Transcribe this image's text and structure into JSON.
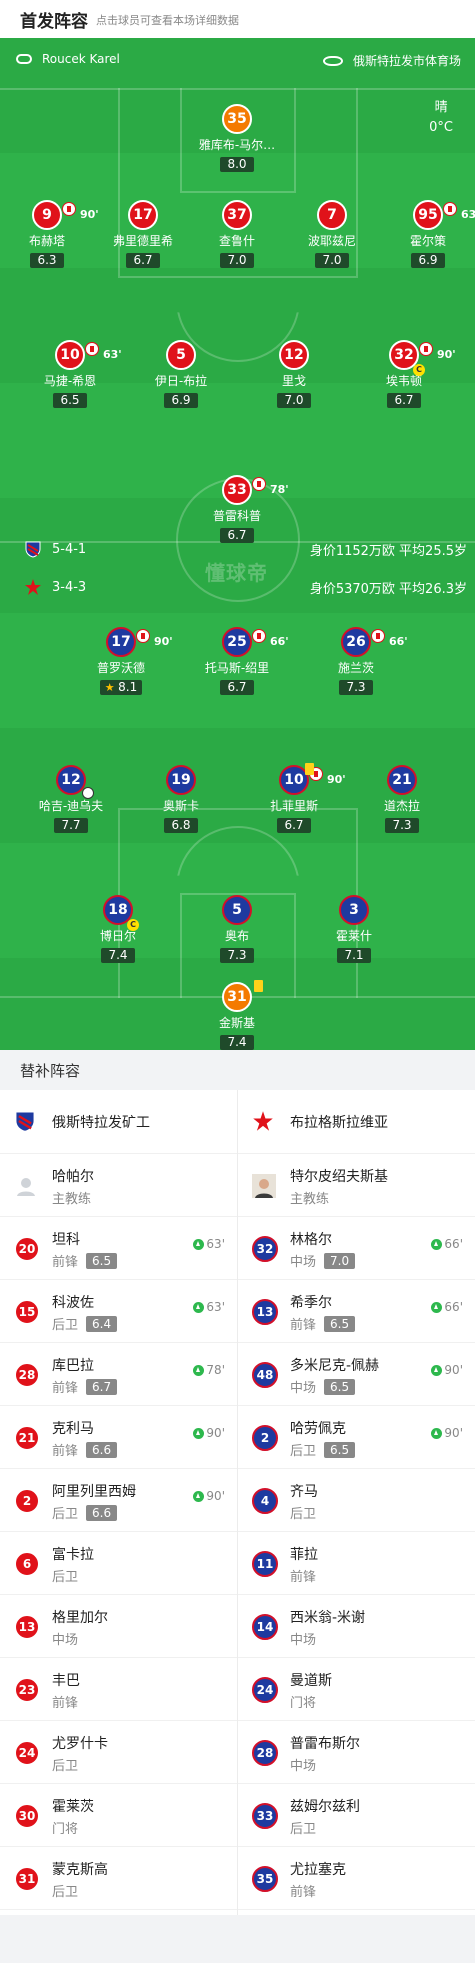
{
  "header": {
    "title": "首发阵容",
    "subtitle": "点击球员可查看本场详细数据"
  },
  "match": {
    "referee": "Roucek Karel",
    "venue": "俄斯特拉发市体育场",
    "weather": "晴",
    "temp": "0°C",
    "watermark": "懂球帝"
  },
  "home_team": {
    "formation": "5-4-1",
    "value": "身价1152万欧 平均25.5岁"
  },
  "away_team": {
    "formation": "3-4-3",
    "value": "身价5370万欧 平均26.3岁"
  },
  "home_players": [
    {
      "num": "35",
      "name": "雅库布-马尔…",
      "rating": "8.0",
      "sub": "",
      "gk": true
    },
    {
      "num": "9",
      "name": "布赫塔",
      "rating": "6.3",
      "sub": "90'"
    },
    {
      "num": "17",
      "name": "弗里德里希",
      "rating": "6.7",
      "sub": ""
    },
    {
      "num": "37",
      "name": "查鲁什",
      "rating": "7.0",
      "sub": ""
    },
    {
      "num": "7",
      "name": "波耶兹尼",
      "rating": "7.0",
      "sub": ""
    },
    {
      "num": "95",
      "name": "霍尔策",
      "rating": "6.9",
      "sub": "63'"
    },
    {
      "num": "10",
      "name": "马捷-希恩",
      "rating": "6.5",
      "sub": "63'"
    },
    {
      "num": "5",
      "name": "伊日-布拉",
      "rating": "6.9",
      "sub": ""
    },
    {
      "num": "12",
      "name": "里戈",
      "rating": "7.0",
      "sub": ""
    },
    {
      "num": "32",
      "name": "埃韦顿",
      "rating": "6.7",
      "sub": "90'",
      "captain": true
    },
    {
      "num": "33",
      "name": "普雷科普",
      "rating": "6.7",
      "sub": "78'"
    }
  ],
  "away_players": [
    {
      "num": "17",
      "name": "普罗沃德",
      "rating": "8.1",
      "sub": "90'",
      "mvp": true
    },
    {
      "num": "25",
      "name": "托马斯-绍里",
      "rating": "6.7",
      "sub": "66'"
    },
    {
      "num": "26",
      "name": "施兰茨",
      "rating": "7.3",
      "sub": "66'"
    },
    {
      "num": "12",
      "name": "哈吉-迪乌夫",
      "rating": "7.7",
      "sub": "",
      "goal": true
    },
    {
      "num": "19",
      "name": "奥斯卡",
      "rating": "6.8",
      "sub": ""
    },
    {
      "num": "10",
      "name": "扎菲里斯",
      "rating": "6.7",
      "sub": "90'",
      "yellow": true
    },
    {
      "num": "21",
      "name": "道杰拉",
      "rating": "7.3",
      "sub": ""
    },
    {
      "num": "18",
      "name": "博日尔",
      "rating": "7.4",
      "sub": "",
      "captain": true
    },
    {
      "num": "5",
      "name": "奥布",
      "rating": "7.3",
      "sub": ""
    },
    {
      "num": "3",
      "name": "霍莱什",
      "rating": "7.1",
      "sub": ""
    },
    {
      "num": "31",
      "name": "金斯基",
      "rating": "7.4",
      "sub": "",
      "gk": true,
      "yellow": true
    }
  ],
  "bench": {
    "title": "替补阵容",
    "home": {
      "team": "俄斯特拉发矿工",
      "coach": {
        "name": "哈帕尔",
        "role": "主教练"
      },
      "players": [
        {
          "num": "20",
          "name": "坦科",
          "pos": "前锋",
          "rating": "6.5",
          "sub": "63'"
        },
        {
          "num": "15",
          "name": "科波佐",
          "pos": "后卫",
          "rating": "6.4",
          "sub": "63'"
        },
        {
          "num": "28",
          "name": "库巴拉",
          "pos": "前锋",
          "rating": "6.7",
          "sub": "78'"
        },
        {
          "num": "21",
          "name": "克利马",
          "pos": "前锋",
          "rating": "6.6",
          "sub": "90'"
        },
        {
          "num": "2",
          "name": "阿里列里西姆",
          "pos": "后卫",
          "rating": "6.6",
          "sub": "90'"
        },
        {
          "num": "6",
          "name": "富卡拉",
          "pos": "后卫",
          "rating": "",
          "sub": ""
        },
        {
          "num": "13",
          "name": "格里加尔",
          "pos": "中场",
          "rating": "",
          "sub": ""
        },
        {
          "num": "23",
          "name": "丰巴",
          "pos": "前锋",
          "rating": "",
          "sub": ""
        },
        {
          "num": "24",
          "name": "尤罗什卡",
          "pos": "后卫",
          "rating": "",
          "sub": ""
        },
        {
          "num": "30",
          "name": "霍莱茨",
          "pos": "门将",
          "rating": "",
          "sub": ""
        },
        {
          "num": "31",
          "name": "蒙克斯高",
          "pos": "后卫",
          "rating": "",
          "sub": ""
        }
      ]
    },
    "away": {
      "team": "布拉格斯拉维亚",
      "coach": {
        "name": "特尔皮绍夫斯基",
        "role": "主教练"
      },
      "players": [
        {
          "num": "32",
          "name": "林格尔",
          "pos": "中场",
          "rating": "7.0",
          "sub": "66'"
        },
        {
          "num": "13",
          "name": "希季尔",
          "pos": "前锋",
          "rating": "6.5",
          "sub": "66'"
        },
        {
          "num": "48",
          "name": "多米尼克-佩赫",
          "pos": "中场",
          "rating": "6.5",
          "sub": "90'"
        },
        {
          "num": "2",
          "name": "哈劳佩克",
          "pos": "后卫",
          "rating": "6.5",
          "sub": "90'"
        },
        {
          "num": "4",
          "name": "齐马",
          "pos": "后卫",
          "rating": "",
          "sub": ""
        },
        {
          "num": "11",
          "name": "菲拉",
          "pos": "前锋",
          "rating": "",
          "sub": ""
        },
        {
          "num": "14",
          "name": "西米翁-米谢",
          "pos": "中场",
          "rating": "",
          "sub": ""
        },
        {
          "num": "24",
          "name": "曼道斯",
          "pos": "门将",
          "rating": "",
          "sub": ""
        },
        {
          "num": "28",
          "name": "普雷布斯尔",
          "pos": "中场",
          "rating": "",
          "sub": ""
        },
        {
          "num": "33",
          "name": "兹姆尔兹利",
          "pos": "后卫",
          "rating": "",
          "sub": ""
        },
        {
          "num": "35",
          "name": "尤拉塞克",
          "pos": "前锋",
          "rating": "",
          "sub": ""
        }
      ]
    }
  }
}
